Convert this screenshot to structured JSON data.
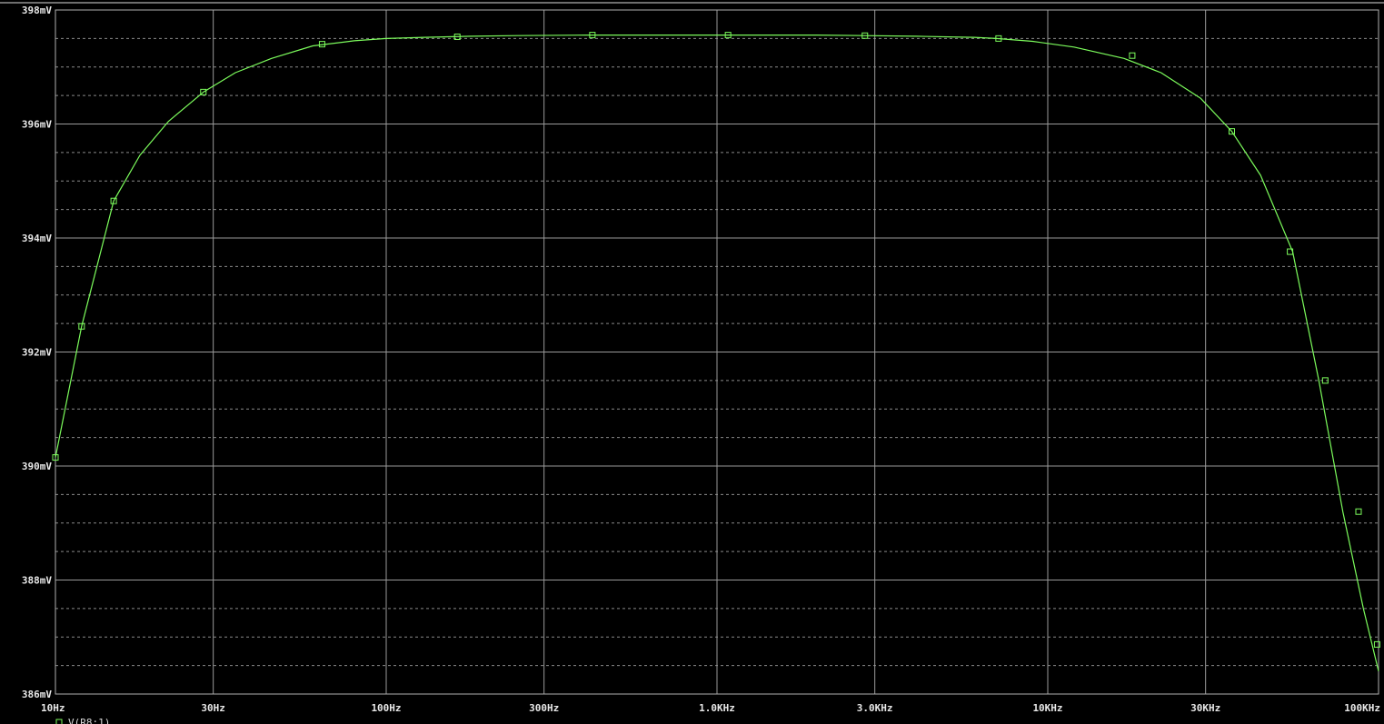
{
  "chart_data": {
    "type": "line",
    "x_scale": "log",
    "xlim": [
      10,
      100000
    ],
    "ylim": [
      386,
      398
    ],
    "y_unit": "mV",
    "x_unit": "Hz",
    "grid": true,
    "x_ticks": [
      {
        "value": 10,
        "label": "10Hz"
      },
      {
        "value": 30,
        "label": "30Hz"
      },
      {
        "value": 100,
        "label": "100Hz"
      },
      {
        "value": 300,
        "label": "300Hz"
      },
      {
        "value": 1000,
        "label": "1.0KHz"
      },
      {
        "value": 3000,
        "label": "3.0KHz"
      },
      {
        "value": 10000,
        "label": "10KHz"
      },
      {
        "value": 30000,
        "label": "30KHz"
      },
      {
        "value": 100000,
        "label": "100KHz"
      }
    ],
    "y_ticks": [
      {
        "value": 398,
        "label": "398mV"
      },
      {
        "value": 396,
        "label": "396mV"
      },
      {
        "value": 394,
        "label": "394mV"
      },
      {
        "value": 392,
        "label": "392mV"
      },
      {
        "value": 390,
        "label": "390mV"
      },
      {
        "value": 388,
        "label": "388mV"
      },
      {
        "value": 386,
        "label": "386mV"
      }
    ],
    "series": [
      {
        "name": "V(R8:1)",
        "color": "#7CFC5C",
        "x": [
          10,
          12,
          15,
          18,
          22,
          28,
          35,
          45,
          60,
          80,
          100,
          130,
          180,
          250,
          400,
          700,
          1100,
          2000,
          2800,
          4000,
          6000,
          7000,
          9000,
          12000,
          17000,
          22000,
          29000,
          36000,
          44000,
          55000,
          66000,
          78000,
          90000,
          100000
        ],
        "y": [
          390.15,
          392.45,
          394.65,
          395.45,
          396.05,
          396.56,
          396.9,
          397.15,
          397.37,
          397.46,
          397.5,
          397.52,
          397.54,
          397.55,
          397.56,
          397.56,
          397.56,
          397.56,
          397.55,
          397.54,
          397.52,
          397.5,
          397.45,
          397.35,
          397.15,
          396.9,
          396.45,
          395.87,
          395.1,
          393.76,
          391.5,
          389.2,
          387.5,
          386.4
        ]
      }
    ],
    "markers": [
      {
        "x": 10,
        "y": 390.15
      },
      {
        "x": 12,
        "y": 392.45
      },
      {
        "x": 15,
        "y": 394.65
      },
      {
        "x": 28,
        "y": 396.56
      },
      {
        "x": 64,
        "y": 397.4
      },
      {
        "x": 164,
        "y": 397.53
      },
      {
        "x": 420,
        "y": 397.56
      },
      {
        "x": 1080,
        "y": 397.56
      },
      {
        "x": 2800,
        "y": 397.55
      },
      {
        "x": 7100,
        "y": 397.5
      },
      {
        "x": 18000,
        "y": 397.2
      },
      {
        "x": 36000,
        "y": 395.87
      },
      {
        "x": 54000,
        "y": 393.76
      },
      {
        "x": 69000,
        "y": 391.5
      },
      {
        "x": 87000,
        "y": 389.2
      },
      {
        "x": 99000,
        "y": 386.87
      }
    ]
  }
}
